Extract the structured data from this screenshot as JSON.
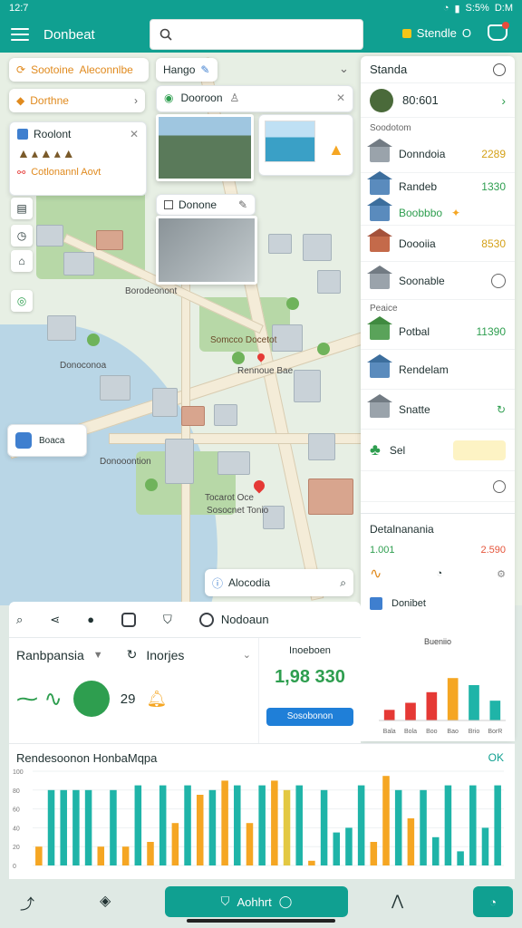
{
  "status": {
    "time": "12:7",
    "battery": "S:5%",
    "clock": "D:M"
  },
  "app": {
    "title": "Donbeat",
    "studio_label": "Stendle",
    "studio_suffix": "O"
  },
  "search": {
    "placeholder": "",
    "value": ""
  },
  "map": {
    "chips": {
      "filter_1": {
        "a": "Sootoine",
        "b": "Aleconnlbe"
      },
      "filter_2": "Dorthne",
      "filter_3": "Hango",
      "popup_1": "Dooroon",
      "popup_2": "Donone",
      "info_title": "Roolont",
      "info_line": "Cotlonannl Aovt",
      "badge_label": "Boaca",
      "search_chip": "Alocodia"
    },
    "labels": [
      "Borodeonont",
      "Donoconoa",
      "Somcco Docetot",
      "Rennoue Bae",
      "Donooontion",
      "Tocarot Oce",
      "Sosocnet Tonio"
    ]
  },
  "right_panel": {
    "header": "Standa",
    "top_row": {
      "label": "80:601"
    },
    "section": "Soodotom",
    "items": [
      {
        "label": "Donndoia",
        "value": "2289",
        "color": "yellow"
      },
      {
        "label": "Randeb",
        "value": "1330",
        "color": "green"
      },
      {
        "label": "Boobbbo",
        "value": "",
        "color": "green"
      },
      {
        "label": "Doooiia",
        "value": "8530",
        "color": "yellow"
      },
      {
        "label": "Soonable",
        "value": "",
        "color": ""
      },
      {
        "label": "Potbal",
        "value": "11390",
        "color": "green"
      },
      {
        "label": "Rendelam",
        "value": "",
        "color": ""
      },
      {
        "label": "Snatte",
        "value": "",
        "color": ""
      },
      {
        "label": "Sel",
        "value": "",
        "color": ""
      }
    ],
    "section_2": "Peaice",
    "detail": {
      "title": "Detalnanania",
      "left_value": "1.001",
      "right_value": "2.590",
      "row_label": "Donibet",
      "chart_title": "Bueniio",
      "x_labels": [
        "Bala",
        "Bola",
        "Boo",
        "Bao",
        "Brio",
        "BorR"
      ]
    }
  },
  "toolbar": {
    "right_label": "Nodoaun"
  },
  "kpi": {
    "select_1": "Ranbpansia",
    "select_2": "Inorjes",
    "number": "29",
    "right_title": "Inoeboen",
    "big_value": "1,98 330",
    "button_label": "Sosobonon"
  },
  "bottom_chart": {
    "title": "Rendesoonon HonbaMqpa",
    "ok": "OK",
    "y_ticks": [
      "100",
      "80",
      "60",
      "40",
      "20",
      "0"
    ]
  },
  "bottom_bar": {
    "center_label": "Aohhrt"
  },
  "chart_data": [
    {
      "type": "bar",
      "title": "Bueniio",
      "categories": [
        "Bala",
        "Bola",
        "Boo",
        "Bao",
        "Brio",
        "BorR"
      ],
      "values": [
        15,
        25,
        40,
        60,
        50,
        28
      ],
      "colors": [
        "#e53935",
        "#e53935",
        "#e53935",
        "#f5a623",
        "#1fb4a8",
        "#1fb4a8"
      ],
      "ylim": [
        0,
        100
      ]
    },
    {
      "type": "bar",
      "title": "Rendesoonon HonbaMqpa",
      "values": [
        20,
        80,
        80,
        80,
        80,
        20,
        80,
        20,
        85,
        25,
        85,
        45,
        85,
        75,
        80,
        90,
        85,
        45,
        85,
        90,
        80,
        85,
        5,
        80,
        35,
        40,
        85,
        25,
        95,
        80,
        50,
        80,
        30,
        85,
        15,
        85,
        40,
        85
      ],
      "colors": [
        "#f5a623",
        "#1fb4a8",
        "#1fb4a8",
        "#1fb4a8",
        "#1fb4a8",
        "#f5a623",
        "#1fb4a8",
        "#f5a623",
        "#1fb4a8",
        "#f5a623",
        "#1fb4a8",
        "#f5a623",
        "#1fb4a8",
        "#f5a623",
        "#1fb4a8",
        "#f5a623",
        "#1fb4a8",
        "#f5a623",
        "#1fb4a8",
        "#f5a623",
        "#e3c842",
        "#1fb4a8",
        "#f5a623",
        "#1fb4a8",
        "#1fb4a8",
        "#1fb4a8",
        "#1fb4a8",
        "#f5a623",
        "#f5a623",
        "#1fb4a8",
        "#f5a623",
        "#1fb4a8",
        "#1fb4a8",
        "#1fb4a8",
        "#1fb4a8",
        "#1fb4a8",
        "#1fb4a8",
        "#1fb4a8"
      ],
      "ylim": [
        0,
        100
      ]
    }
  ]
}
